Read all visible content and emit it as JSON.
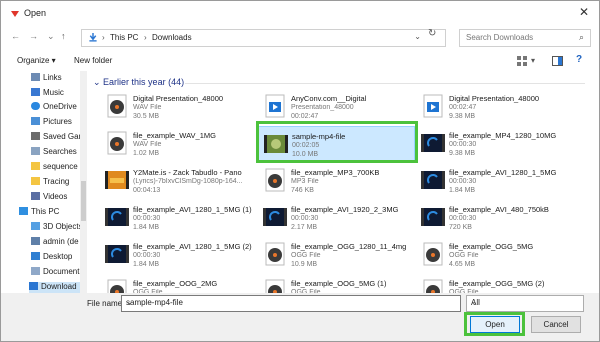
{
  "window": {
    "title": "Open",
    "close_glyph": "✕"
  },
  "nav": {
    "breadcrumb": [
      "This PC",
      "Downloads"
    ],
    "search_placeholder": "Search Downloads"
  },
  "toolbar": {
    "organize": "Organize ▾",
    "new_folder": "New folder"
  },
  "sidebar": {
    "items": [
      {
        "label": "Links",
        "icon": "links-icon"
      },
      {
        "label": "Music",
        "icon": "music-icon"
      },
      {
        "label": "OneDrive",
        "icon": "onedrive-icon"
      },
      {
        "label": "Pictures",
        "icon": "pictures-icon"
      },
      {
        "label": "Saved Gam",
        "icon": "saved-games-icon"
      },
      {
        "label": "Searches",
        "icon": "searches-icon"
      },
      {
        "label": "sequence",
        "icon": "folder-icon"
      },
      {
        "label": "Tracing",
        "icon": "folder-icon"
      },
      {
        "label": "Videos",
        "icon": "videos-icon"
      },
      {
        "label": "This PC",
        "icon": "pc-icon"
      },
      {
        "label": "3D Objects",
        "icon": "3d-objects-icon"
      },
      {
        "label": "admin (de",
        "icon": "network-icon"
      },
      {
        "label": "Desktop",
        "icon": "desktop-icon"
      },
      {
        "label": "Document",
        "icon": "documents-icon"
      },
      {
        "label": "Download",
        "icon": "downloads-icon"
      }
    ]
  },
  "group": {
    "title": "Earlier this year (44)"
  },
  "files": [
    {
      "name": "Digital Presentation_48000",
      "l2": "WAV File",
      "l3": "30.5 MB",
      "kind": "disc"
    },
    {
      "name": "AnyConv.com__Digital",
      "l2": "Presentation_48000",
      "l3": "00:02:47",
      "kind": "media"
    },
    {
      "name": "Digital Presentation_48000",
      "l2": "00:02:47",
      "l3": "9.38 MB",
      "kind": "media"
    },
    {
      "name": "file_example_WAV_1MG",
      "l2": "WAV File",
      "l3": "1.02 MB",
      "kind": "disc"
    },
    {
      "name": "sample-mp4-file",
      "l2": "00:02:05",
      "l3": "10.0 MB",
      "kind": "video"
    },
    {
      "name": "file_example_MP4_1280_10MG",
      "l2": "00:00:30",
      "l3": "9.38 MB",
      "kind": "film"
    },
    {
      "name": "Y2Mate.is - Zack Tabudlo - Pano",
      "l2": "(Lyrics)-7bIxvClSmDg-1080p-164...",
      "l3": "00:04:13",
      "kind": "orange"
    },
    {
      "name": "file_example_MP3_700KB",
      "l2": "MP3 File",
      "l3": "746 KB",
      "kind": "disc"
    },
    {
      "name": "file_example_AVI_1280_1_5MG",
      "l2": "00:00:30",
      "l3": "1.84 MB",
      "kind": "film"
    },
    {
      "name": "file_example_AVI_1280_1_5MG (1)",
      "l2": "00:00:30",
      "l3": "1.84 MB",
      "kind": "film"
    },
    {
      "name": "file_example_AVI_1920_2_3MG",
      "l2": "00:00:30",
      "l3": "2.17 MB",
      "kind": "film"
    },
    {
      "name": "file_example_AVI_480_750kB",
      "l2": "00:00:30",
      "l3": "720 KB",
      "kind": "film"
    },
    {
      "name": "file_example_AVI_1280_1_5MG (2)",
      "l2": "00:00:30",
      "l3": "1.84 MB",
      "kind": "film"
    },
    {
      "name": "file_example_OGG_1280_11_4mg",
      "l2": "OGG File",
      "l3": "10.9 MB",
      "kind": "disc"
    },
    {
      "name": "file_example_OGG_5MG",
      "l2": "OGG File",
      "l3": "4.65 MB",
      "kind": "disc"
    },
    {
      "name": "file_example_OOG_2MG",
      "l2": "OGG File",
      "l3": "",
      "kind": "disc"
    },
    {
      "name": "file_example_OOG_5MG (1)",
      "l2": "OGG File",
      "l3": "",
      "kind": "disc"
    },
    {
      "name": "file_example_OGG_5MG (2)",
      "l2": "OGG File",
      "l3": "",
      "kind": "disc"
    }
  ],
  "bottom": {
    "file_name_label": "File name:",
    "file_name_value": "sample-mp4-file",
    "file_type": "All",
    "open": "Open",
    "cancel": "Cancel"
  },
  "colors": {
    "highlight": "#4cc23c",
    "selection": "#cce8ff",
    "link": "#1e3287"
  }
}
